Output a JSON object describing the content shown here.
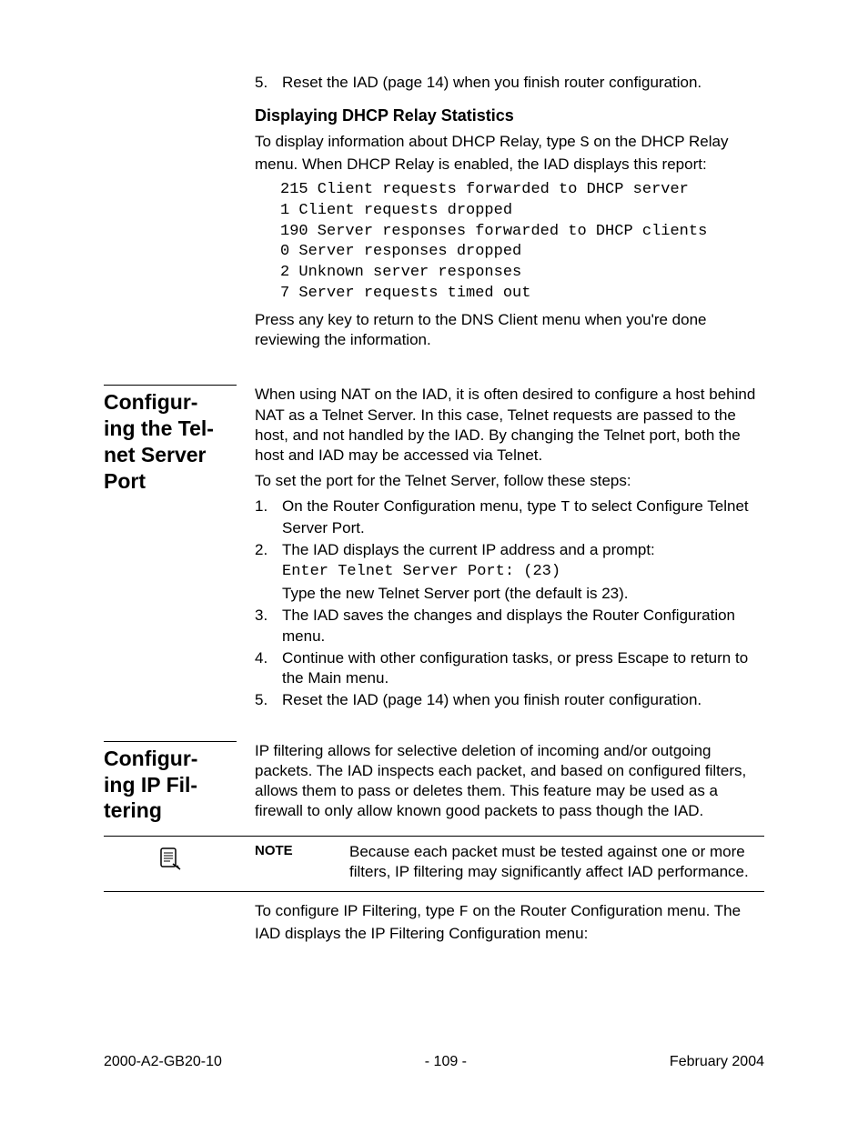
{
  "top": {
    "step5_num": "5.",
    "step5": "Reset the IAD (page 14) when you finish router configuration.",
    "sub_heading": "Displaying DHCP Relay Statistics",
    "para1_a": "To display information about DHCP Relay, type ",
    "para1_key": "S",
    "para1_b": " on the DHCP Relay menu. When DHCP Relay is enabled, the IAD displays this report:",
    "report": "215 Client requests forwarded to DHCP server\n1 Client requests dropped\n190 Server responses forwarded to DHCP clients\n0 Server responses dropped\n2 Unknown server responses\n7 Server requests timed out",
    "para2": "Press any key to return to the DNS Client menu when you're done reviewing the information."
  },
  "telnet": {
    "heading": "Configur-ing the Tel-net Server Port",
    "para1": "When using NAT on the IAD, it is often desired to configure a host behind NAT as a Telnet Server. In this case, Telnet requests are passed to the host, and not handled by the IAD. By changing the Telnet port, both the host and IAD may be accessed via Telnet.",
    "para2": "To set the port for the Telnet Server, follow these steps:",
    "steps": [
      {
        "num": "1.",
        "a": "On the Router Configuration menu, type ",
        "key": "T",
        "b": "  to select Configure Telnet Server Port."
      },
      {
        "num": "2.",
        "line1": "The IAD displays the current IP address and a prompt:",
        "mono": "Enter Telnet Server Port: (23)",
        "line2": "Type the new Telnet Server port (the default is 23)."
      },
      {
        "num": "3.",
        "a": "The IAD saves the changes and displays the Router Configuration menu."
      },
      {
        "num": "4.",
        "a": "Continue with other configuration tasks, or press Escape to return to the Main menu."
      },
      {
        "num": "5.",
        "a": "Reset the IAD (page 14) when you finish router configuration."
      }
    ]
  },
  "ipfilter": {
    "heading": "Configur-ing IP Fil-tering",
    "para1": "IP filtering allows for selective deletion of incoming and/or outgoing packets. The IAD inspects each packet, and based on configured filters, allows them to pass or deletes them. This feature may be used as a firewall to only allow known good packets to pass though the IAD.",
    "note_label": "NOTE",
    "note_text": "Because each packet must be tested against one or more filters, IP filtering may significantly affect IAD performance.",
    "para2_a": "To configure IP Filtering, type ",
    "para2_key": "F",
    "para2_b": " on the Router Configuration menu. The IAD displays the IP Filtering Configuration menu:"
  },
  "footer": {
    "left": "2000-A2-GB20-10",
    "center": "- 109 -",
    "right": "February 2004"
  }
}
